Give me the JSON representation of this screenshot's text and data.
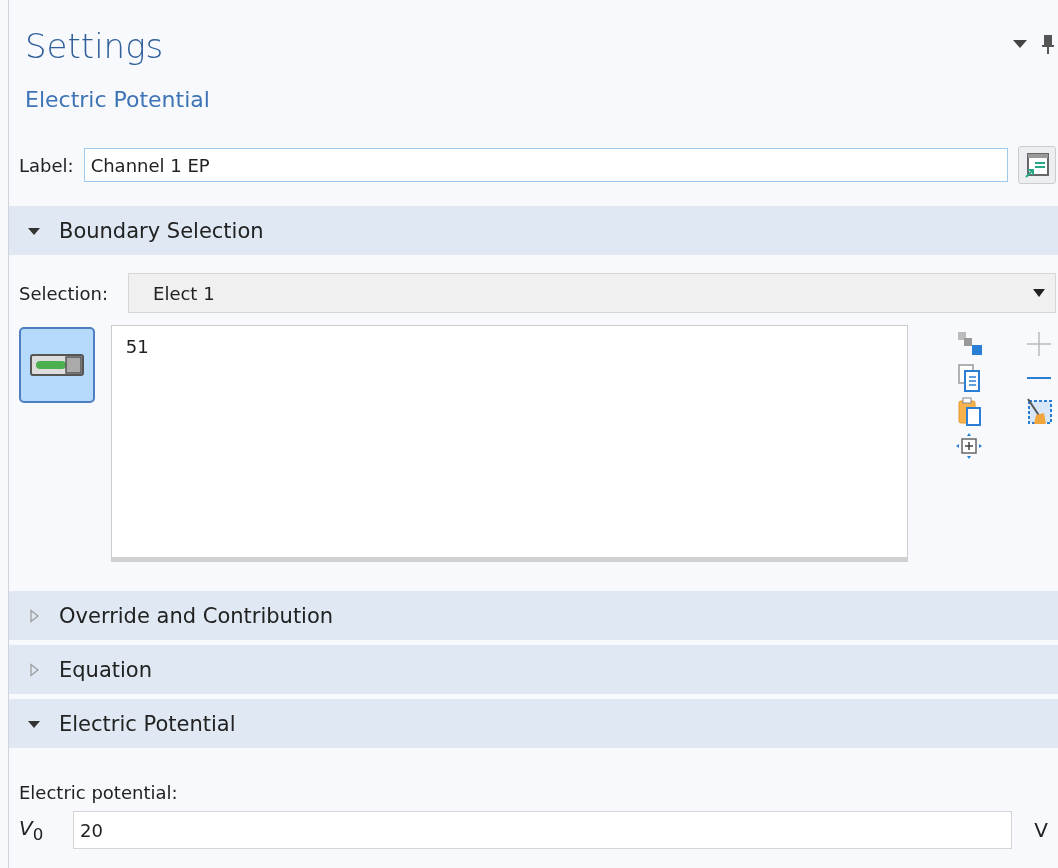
{
  "header": {
    "title": "Settings",
    "subtitle": "Electric Potential"
  },
  "label": {
    "caption": "Label:",
    "value": "Channel 1 EP"
  },
  "sections": [
    {
      "title": "Boundary Selection",
      "expanded": true,
      "kind": "selection",
      "selection": {
        "caption": "Selection:",
        "value": "Elect 1",
        "entities": [
          "51"
        ],
        "active": true
      }
    },
    {
      "title": "Override and Contribution",
      "expanded": false
    },
    {
      "title": "Equation",
      "expanded": false
    },
    {
      "title": "Electric Potential",
      "expanded": true,
      "kind": "quantity",
      "quantity": {
        "caption": "Electric potential:",
        "symbol": "*V*$_{0}$",
        "value": "20",
        "unit": "V"
      }
    }
  ]
}
